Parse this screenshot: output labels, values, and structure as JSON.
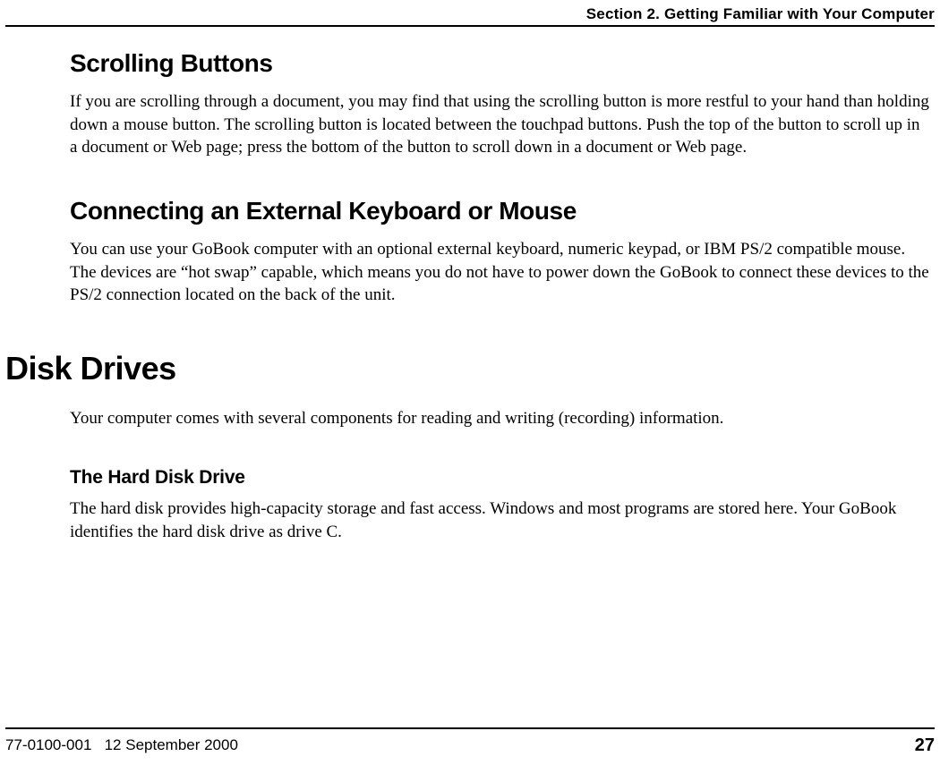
{
  "header": {
    "section_title": "Section 2. Getting Familiar with Your Computer"
  },
  "sections": {
    "scrolling": {
      "heading": "Scrolling Buttons",
      "body": "If you are scrolling through a document, you may find that using the scrolling button is more restful to your hand than holding down a mouse button. The scrolling button is located between the touchpad buttons. Push the top of the button to scroll up in a document or Web page; press the bottom of the button to scroll down in a document or Web page."
    },
    "external": {
      "heading": "Connecting an External Keyboard or Mouse",
      "body": "You can use your GoBook computer with an optional external keyboard, numeric keypad, or IBM PS/2 compatible mouse. The devices are “hot swap” capable, which means you do not have to power down the GoBook to connect these devices to the PS/2 connection located on the back of the unit."
    },
    "disk": {
      "heading": "Disk Drives",
      "intro": "Your computer comes with several components for reading and writing (recording) information.",
      "hdd_heading": "The Hard Disk Drive",
      "hdd_body": "The hard disk provides high-capacity storage and fast access. Windows and most programs are stored here. Your GoBook identifies the hard disk drive as drive C."
    }
  },
  "footer": {
    "doc_id": "77-0100-001",
    "date": "12 September 2000",
    "page": "27"
  }
}
